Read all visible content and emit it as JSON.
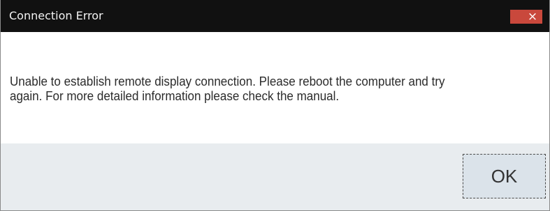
{
  "window": {
    "title": "Connection Error",
    "close_label": "×"
  },
  "message": {
    "line1": "Unable to establish remote display connection. Please reboot the computer and try",
    "line2": "again. For more detailed information please check the manual."
  },
  "buttons": {
    "ok_label": "OK"
  },
  "colors": {
    "titlebar_bg": "#111111",
    "close_bg": "#c9483c",
    "footer_bg": "#e8ecef",
    "ok_bg": "#dbe3ea"
  }
}
